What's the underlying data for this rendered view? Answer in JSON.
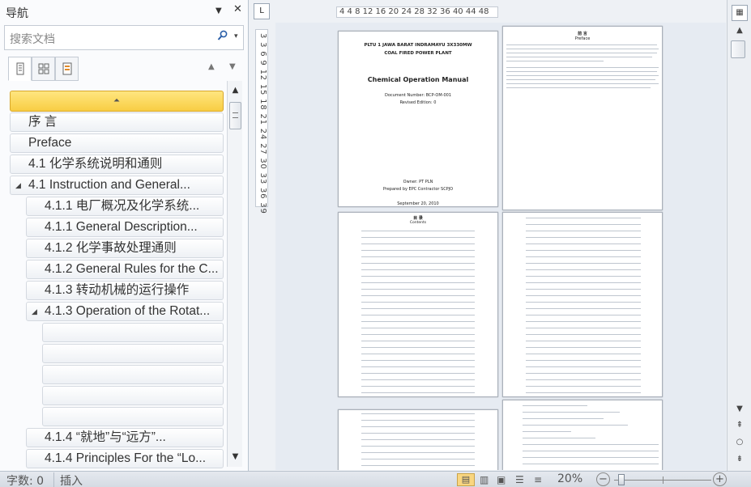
{
  "nav": {
    "title": "导航",
    "dropdown_icon": "▼",
    "close_icon": "✕",
    "search_placeholder": "搜索文档",
    "search_icon": "search-icon",
    "tabs": [
      "headings-tab",
      "pages-tab",
      "results-tab"
    ],
    "prev_arrow": "▲",
    "next_arrow": "▼",
    "collapse_icon": "⏶",
    "items": [
      {
        "label": "序  言",
        "level": 1,
        "expanded": false
      },
      {
        "label": "Preface",
        "level": 1,
        "expanded": false
      },
      {
        "label": "4.1      化学系统说明和通则",
        "level": 1,
        "expanded": false
      },
      {
        "label": "4.1      Instruction and General...",
        "level": 1,
        "expanded": true
      },
      {
        "label": "4.1.1      电厂概况及化学系统...",
        "level": 2,
        "expanded": false
      },
      {
        "label": "4.1.1      General Description...",
        "level": 2,
        "expanded": false
      },
      {
        "label": "4.1.2      化学事故处理通则",
        "level": 2,
        "expanded": false
      },
      {
        "label": "4.1.2 General Rules for the C...",
        "level": 2,
        "expanded": false
      },
      {
        "label": "4.1.3      转动机械的运行操作",
        "level": 2,
        "expanded": false
      },
      {
        "label": "4.1.3 Operation of the Rotat...",
        "level": 2,
        "expanded": true
      },
      {
        "label": "4.1.4        “就地”与“远方”...",
        "level": 2,
        "expanded": false
      },
      {
        "label": "4.1.4 Principles For the   “Lo...",
        "level": 2,
        "expanded": false
      }
    ]
  },
  "ruler": {
    "horizontal": "4   4  8  12 16 20 24 28 32 36 40 44 48",
    "vertical": "3  3  6  9  12 15 18 21 24 27 30 33 36 39",
    "corner": "L"
  },
  "pages": {
    "p1_line1": "PLTU 1 JAWA BARAT INDRAMAYU 3X330MW",
    "p1_line2": "COAL FIRED POWER PLANT",
    "p1_title": "Chemical Operation Manual",
    "p1_docnum": "Document Number: BCP-OM-001",
    "p1_edition": "Revised Edition: 0",
    "p1_owner": "Owner: PT PLN",
    "p1_prepared": "Prepared by EPC Contractor SCPJO",
    "p1_date": "September 20, 2010",
    "p2_heading": "前  言",
    "p2_title": "Preface",
    "p3_heading": "目  录",
    "p3_sub": "Contents"
  },
  "status": {
    "word_count": "字数: 0",
    "mode": "插入",
    "zoom": "20%",
    "zoom_out": "−",
    "zoom_in": "+"
  }
}
